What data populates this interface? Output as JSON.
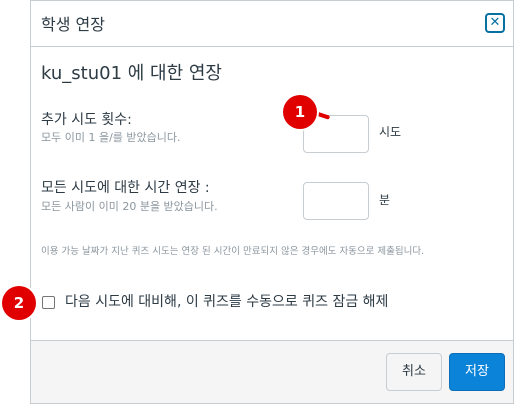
{
  "dialog": {
    "title": "학생 연장",
    "close_glyph": "✕",
    "heading": "ku_stu01 에 대한 연장"
  },
  "attempts": {
    "label": "추가 시도 횟수:",
    "help": "모두 이미 1 을/를 받았습니다.",
    "value": "",
    "unit": "시도"
  },
  "time": {
    "label": "모든 시도에 대한 시간 연장 :",
    "help": "모든 사람이 이미 20 분을 받았습니다.",
    "value": "",
    "unit": "분"
  },
  "note": "이용 가능 날짜가 지난 퀴즈 시도는 연장 된 시간이 만료되지 않은 경우에도 자동으로 제출됩니다.",
  "manual_unlock": {
    "label": "다음 시도에 대비해, 이 퀴즈를 수동으로 퀴즈 잠금 해제",
    "checked": false
  },
  "footer": {
    "cancel_label": "취소",
    "save_label": "저장"
  },
  "annotations": [
    {
      "label": "1"
    },
    {
      "label": "2"
    }
  ],
  "colors": {
    "primary": "#0b83d9",
    "annotation": "#e00000",
    "close_icon": "#0770a3"
  }
}
